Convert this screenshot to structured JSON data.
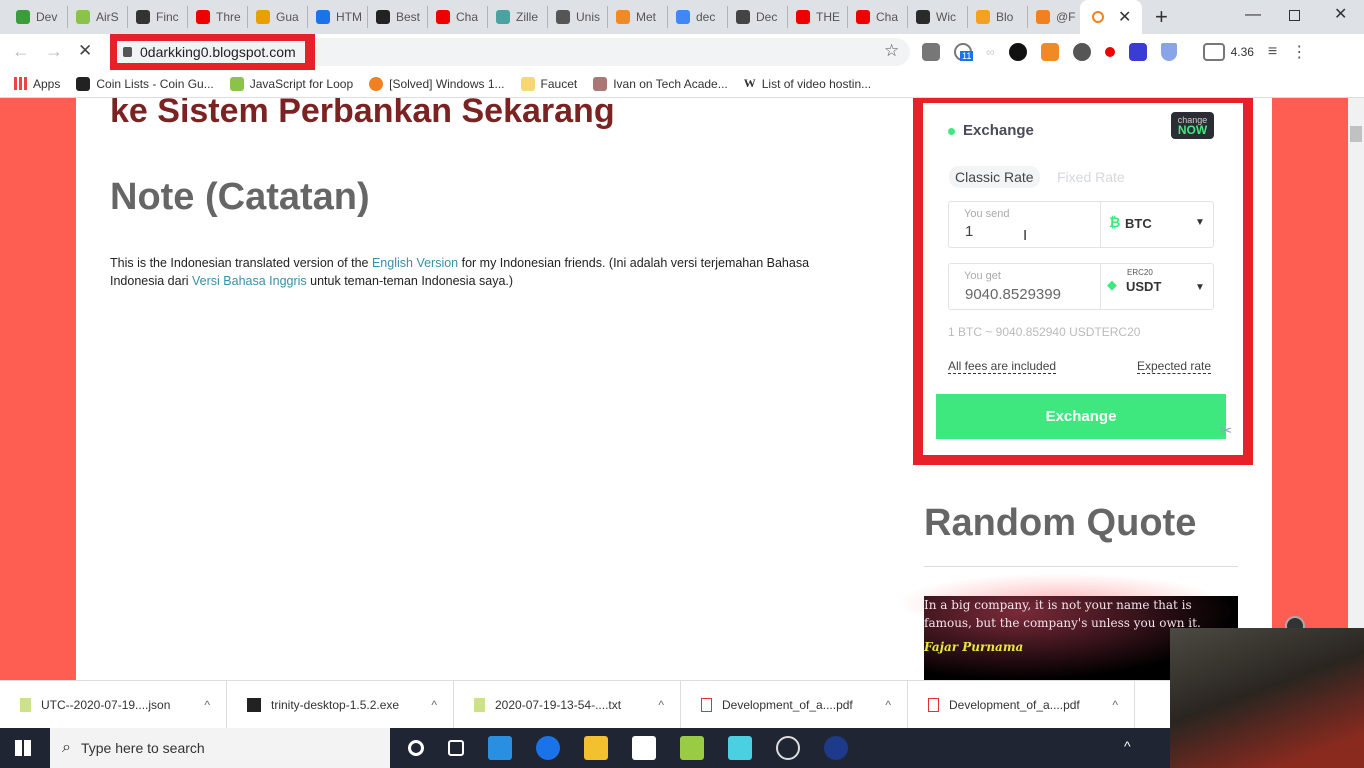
{
  "browser": {
    "tabs": [
      {
        "label": "Dev",
        "color": "#3a9c3a"
      },
      {
        "label": "AirS",
        "color": "#8bc34a"
      },
      {
        "label": "Finc",
        "color": "#333"
      },
      {
        "label": "Thre",
        "color": "#e00"
      },
      {
        "label": "Gua",
        "color": "#e8a000"
      },
      {
        "label": "HTM",
        "color": "#1a73e8"
      },
      {
        "label": "Best",
        "color": "#222"
      },
      {
        "label": "Cha",
        "color": "#e00"
      },
      {
        "label": "Zille",
        "color": "#4aa3a0"
      },
      {
        "label": "Unis",
        "color": "#555"
      },
      {
        "label": "Met",
        "color": "#f08a24"
      },
      {
        "label": "dec",
        "color": "#4285f4"
      },
      {
        "label": "Dec",
        "color": "#444"
      },
      {
        "label": "THE",
        "color": "#e00"
      },
      {
        "label": "Cha",
        "color": "#e00"
      },
      {
        "label": "Wic",
        "color": "#2a2a2a"
      },
      {
        "label": "Blo",
        "color": "#f4a020"
      },
      {
        "label": "@F",
        "color": "#f08020"
      }
    ],
    "new_tab": "+",
    "url": "0darkking0.blogspot.com",
    "extension_badge": "11",
    "extension_value": "4.36",
    "bookmarks": [
      "Apps",
      "Coin Lists - Coin Gu...",
      "JavaScript for Loop",
      "[Solved] Windows 1...",
      "Faucet",
      "Ivan on Tech Acade...",
      "List of video hostin..."
    ]
  },
  "article": {
    "title_partial": "ke Sistem Perbankan Sekarang",
    "heading": "Note (Catatan)",
    "p1": "This is the Indonesian translated version of the ",
    "link1": "English Version",
    "p2": " for my Indonesian friends. (Ini adalah versi terjemahan Bahasa Indonesia dari ",
    "link2": "Versi Bahasa Inggris",
    "p3": " untuk teman-teman Indonesia saya.)"
  },
  "widget": {
    "title": "Exchange",
    "logo_top": "change",
    "logo_bottom": "NOW",
    "tabs": [
      "Classic Rate",
      "Fixed Rate"
    ],
    "send_label": "You send",
    "send_value": "1",
    "send_currency": "BTC",
    "get_label": "You get",
    "get_value": "9040.8529399",
    "get_network": "ERC20",
    "get_currency": "USDT",
    "rate": "1 BTC ~ 9040.852940 USDTERC20",
    "fees": "All fees are included",
    "expected": "Expected rate",
    "button": "Exchange",
    "accent": "#3ee87f"
  },
  "sidebar": {
    "heading": "Random Quote",
    "quote": "In a big company, it is not your name that is famous, but the company's unless you own it.",
    "author": "Fajar Purnama"
  },
  "downloads": [
    "UTC--2020-07-19....json",
    "trinity-desktop-1.5.2.exe",
    "2020-07-19-13-54-....txt",
    "Development_of_a....pdf",
    "Development_of_a....pdf"
  ],
  "taskbar": {
    "search_placeholder": "Type here to search"
  }
}
